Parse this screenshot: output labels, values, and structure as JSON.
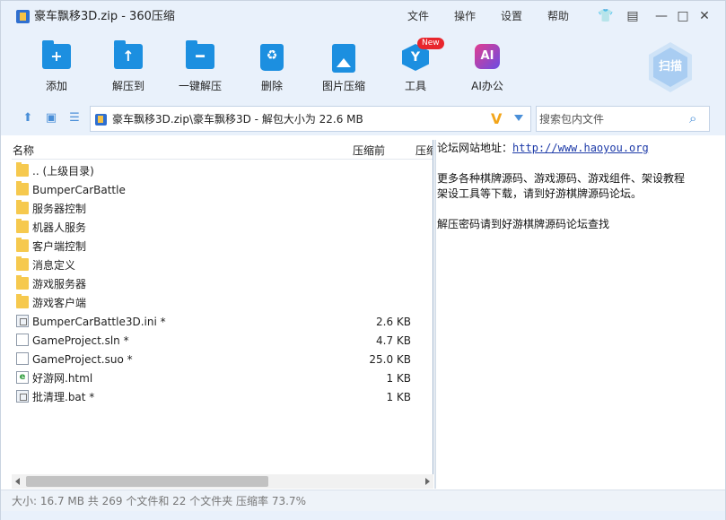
{
  "window": {
    "title": "豪车飘移3D.zip - 360压缩",
    "menu": [
      "文件",
      "操作",
      "设置",
      "帮助"
    ]
  },
  "toolbar": {
    "add_label": "添加",
    "extract_to_label": "解压到",
    "one_click_extract_label": "一键解压",
    "delete_label": "删除",
    "image_compress_label": "图片压缩",
    "tools_label": "工具",
    "tools_badge": "New",
    "ai_label": "AI办公",
    "ai_icon_text": "AI",
    "tools_icon_text": "Y",
    "scan_label": "扫描"
  },
  "address": {
    "path": "豪车飘移3D.zip\\豪车飘移3D - 解包大小为 22.6 MB",
    "search_placeholder": "搜索包内文件"
  },
  "list": {
    "columns": {
      "name": "名称",
      "size_before": "压缩前",
      "size_after": "压缩"
    },
    "rows": [
      {
        "name": ".. (上级目录)",
        "size": "",
        "kind": "folder"
      },
      {
        "name": "BumperCarBattle",
        "size": "",
        "kind": "folder"
      },
      {
        "name": "服务器控制",
        "size": "",
        "kind": "folder"
      },
      {
        "name": "机器人服务",
        "size": "",
        "kind": "folder"
      },
      {
        "name": "客户端控制",
        "size": "",
        "kind": "folder"
      },
      {
        "name": "消息定义",
        "size": "",
        "kind": "folder"
      },
      {
        "name": "游戏服务器",
        "size": "",
        "kind": "folder"
      },
      {
        "name": "游戏客户端",
        "size": "",
        "kind": "folder"
      },
      {
        "name": "BumperCarBattle3D.ini *",
        "size": "2.6 KB",
        "kind": "ini"
      },
      {
        "name": "GameProject.sln *",
        "size": "4.7 KB",
        "kind": "doc"
      },
      {
        "name": "GameProject.suo *",
        "size": "25.0 KB",
        "kind": "doc"
      },
      {
        "name": "好游网.html",
        "size": "1 KB",
        "kind": "html"
      },
      {
        "name": "批清理.bat *",
        "size": "1 KB",
        "kind": "bat"
      }
    ]
  },
  "comment": {
    "line1_label": "论坛网站地址：",
    "line1_link": "http://www.haoyou.org",
    "line2": "更多各种棋牌源码、游戏源码、游戏组件、架设教程",
    "line3": "架设工具等下载，请到好游棋牌源码论坛。",
    "line4": "解压密码请到好游棋牌源码论坛查找"
  },
  "status": {
    "text": "大小: 16.7 MB 共 269 个文件和 22 个文件夹 压缩率 73.7%"
  }
}
